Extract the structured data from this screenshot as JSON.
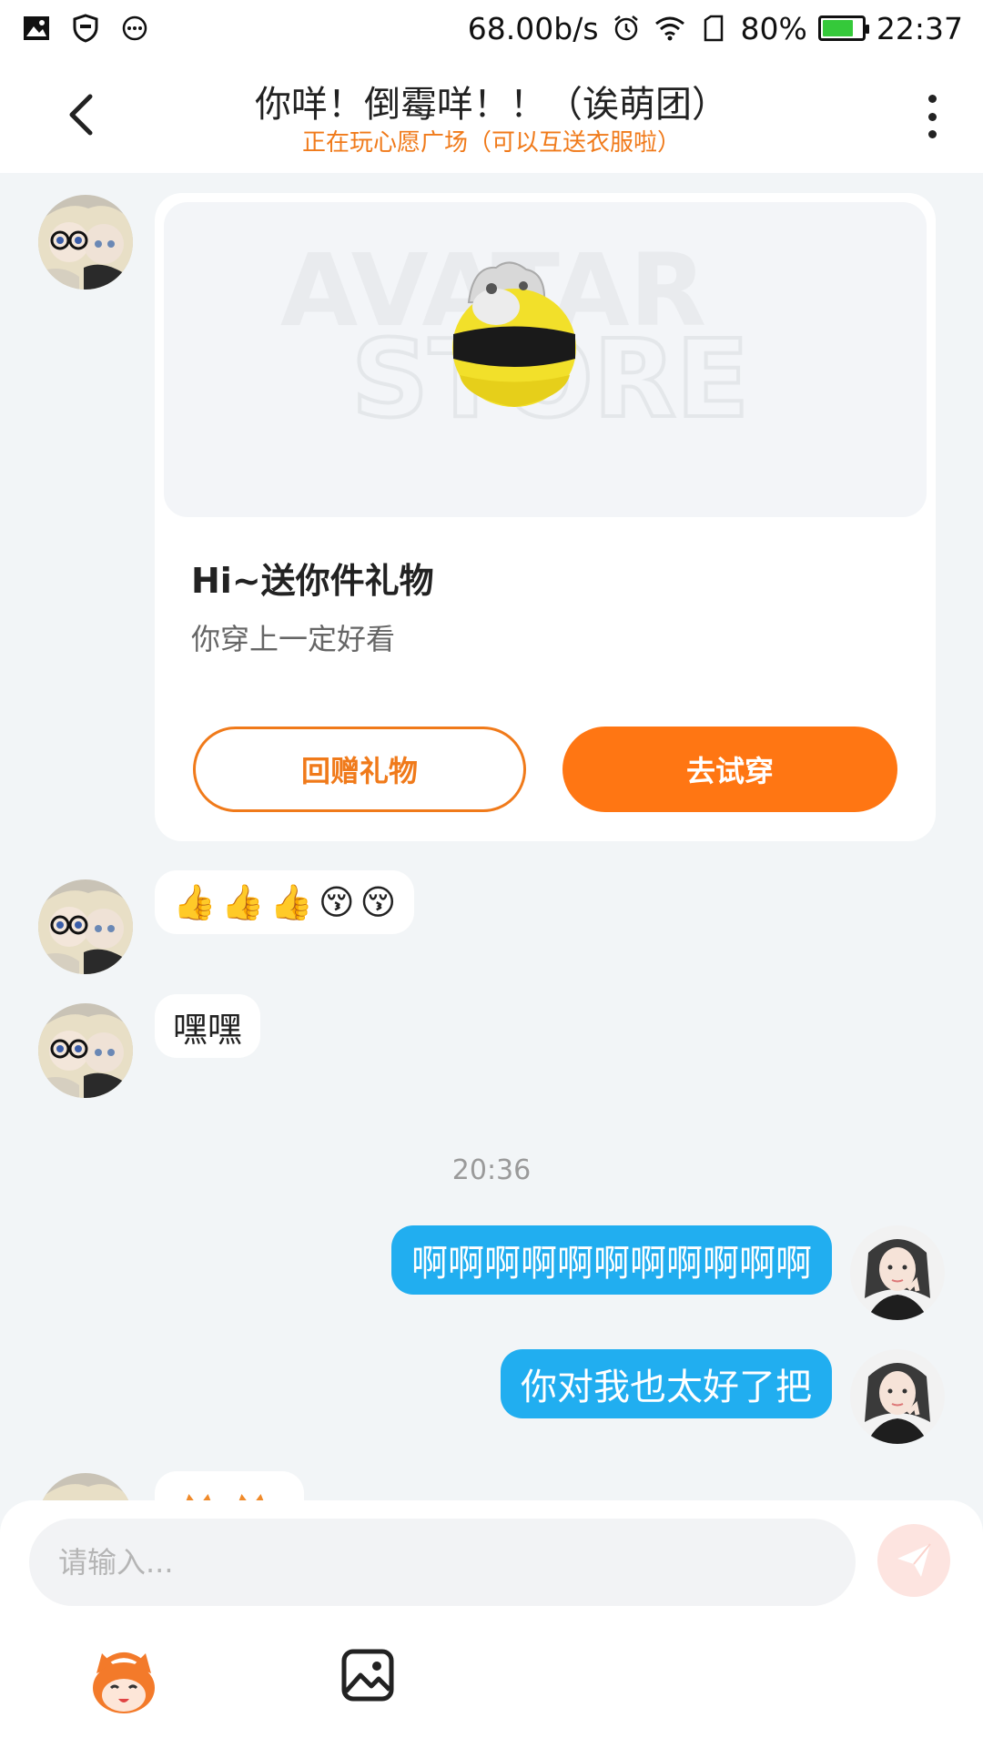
{
  "status_bar": {
    "speed": "68.00b/s",
    "battery_percent": "80%",
    "battery_level": 0.8,
    "time": "22:37",
    "battery_color": "#35c93a"
  },
  "header": {
    "title": "你咩！倒霉咩！！（诶萌团）",
    "subtitle": "正在玩心愿广场（可以互送衣服啦）",
    "accent_color": "#f07a1a"
  },
  "gift_card": {
    "watermark_line1": "AVATAR",
    "watermark_line2": "STORE",
    "title": "Hi~送你件礼物",
    "description": "你穿上一定好看",
    "return_gift_label": "回赠礼物",
    "try_on_label": "去试穿"
  },
  "messages": {
    "emoji_message": [
      "👍",
      "👍",
      "👍",
      "😚",
      "😚"
    ],
    "text_incoming": "嘿嘿",
    "timestamp": "20:36",
    "outgoing_1": "啊啊啊啊啊啊啊啊啊啊啊",
    "outgoing_2": "你对我也太好了把"
  },
  "input": {
    "placeholder": "请输入..."
  },
  "colors": {
    "outgoing_bubble": "#21aef0",
    "primary_button": "#ff7613",
    "background": "#f2f5f7"
  }
}
